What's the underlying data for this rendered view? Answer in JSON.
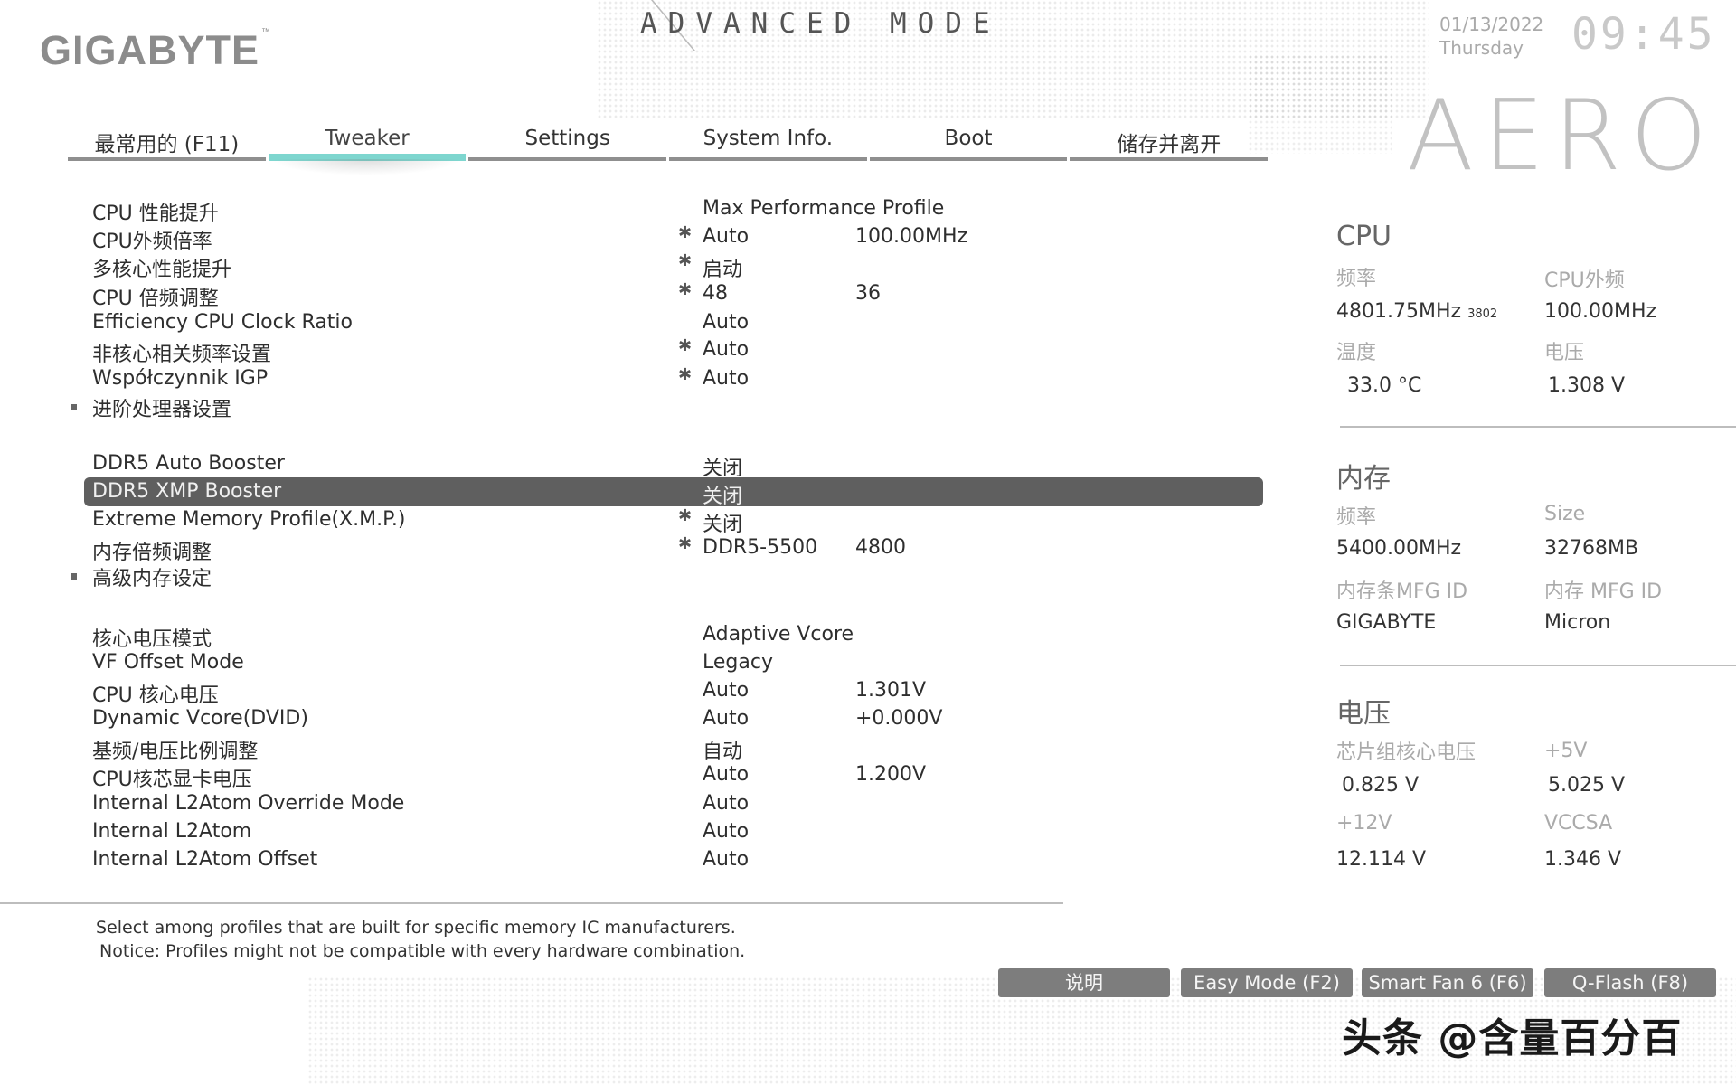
{
  "header": {
    "brand": "GIGABYTE",
    "brand_tm": "™",
    "mode_title": "ADVANCED MODE",
    "date": "01/13/2022",
    "weekday": "Thursday",
    "time": "09:45",
    "product_logo": "AERO"
  },
  "tabs": [
    {
      "label": "最常用的 (F11)"
    },
    {
      "label": "Tweaker",
      "active": true
    },
    {
      "label": "Settings"
    },
    {
      "label": "System Info."
    },
    {
      "label": "Boot"
    },
    {
      "label": "储存并离开"
    }
  ],
  "settings": [
    {
      "label": "CPU 性能提升",
      "value": "Max Performance Profile",
      "value2": "",
      "star": false,
      "submenu": false
    },
    {
      "label": "CPU外频倍率",
      "value": "Auto",
      "value2": "100.00MHz",
      "star": true,
      "submenu": false
    },
    {
      "label": "多核心性能提升",
      "value": "启动",
      "value2": "",
      "star": true,
      "submenu": false
    },
    {
      "label": "CPU 倍频调整",
      "value": "48",
      "value2": "36",
      "star": true,
      "submenu": false
    },
    {
      "label": "Efficiency CPU Clock Ratio",
      "value": "Auto",
      "value2": "",
      "star": false,
      "submenu": false
    },
    {
      "label": "非核心相关频率设置",
      "value": "Auto",
      "value2": "",
      "star": true,
      "submenu": false
    },
    {
      "label": "Współczynnik IGP",
      "value": "Auto",
      "value2": "",
      "star": true,
      "submenu": false
    },
    {
      "label": "进阶处理器设置",
      "value": "",
      "value2": "",
      "star": false,
      "submenu": true
    },
    {
      "label": "DDR5 Auto Booster",
      "value": "关闭",
      "value2": "",
      "star": false,
      "submenu": false
    },
    {
      "label": "DDR5 XMP Booster",
      "value": "关闭",
      "value2": "",
      "star": false,
      "submenu": false,
      "selected": true
    },
    {
      "label": "Extreme Memory Profile(X.M.P.)",
      "value": "关闭",
      "value2": "",
      "star": true,
      "submenu": false
    },
    {
      "label": "内存倍频调整",
      "value": "DDR5-5500",
      "value2": "4800",
      "star": true,
      "submenu": false
    },
    {
      "label": "高级内存设定",
      "value": "",
      "value2": "",
      "star": false,
      "submenu": true
    },
    {
      "label": "核心电压模式",
      "value": "Adaptive Vcore",
      "value2": "",
      "star": false,
      "submenu": false
    },
    {
      "label": "VF Offset Mode",
      "value": "Legacy",
      "value2": "",
      "star": false,
      "submenu": false
    },
    {
      "label": "CPU 核心电压",
      "value": "Auto",
      "value2": "1.301V",
      "star": false,
      "submenu": false
    },
    {
      "label": "Dynamic Vcore(DVID)",
      "value": "Auto",
      "value2": "+0.000V",
      "star": false,
      "submenu": false
    },
    {
      "label": "基频/电压比例调整",
      "value": "自动",
      "value2": "",
      "star": false,
      "submenu": false
    },
    {
      "label": "CPU核芯显卡电压",
      "value": "Auto",
      "value2": "1.200V",
      "star": false,
      "submenu": false
    },
    {
      "label": "Internal L2Atom Override Mode",
      "value": "Auto",
      "value2": "",
      "star": false,
      "submenu": false
    },
    {
      "label": "Internal L2Atom",
      "value": "Auto",
      "value2": "",
      "star": false,
      "submenu": false
    },
    {
      "label": "Internal L2Atom Offset",
      "value": "Auto",
      "value2": "",
      "star": false,
      "submenu": false
    }
  ],
  "help": {
    "line1": "Select among profiles that are built for specific memory IC manufacturers.",
    "line2": "Notice: Profiles might not be compatible with every hardware combination."
  },
  "sidebar": {
    "cpu": {
      "title": "CPU",
      "freq_label": "频率",
      "freq_value": "4801.75MHz",
      "freq_sub": "3802",
      "bclk_label": "CPU外频",
      "bclk_value": "100.00MHz",
      "temp_label": "温度",
      "temp_value": "33.0 °C",
      "volt_label": "电压",
      "volt_value": "1.308 V"
    },
    "memory": {
      "title": "内存",
      "freq_label": "频率",
      "freq_value": "5400.00MHz",
      "size_label": "Size",
      "size_value": "32768MB",
      "module_mfg_label": "内存条MFG ID",
      "module_mfg_value": "GIGABYTE",
      "chip_mfg_label": "内存 MFG ID",
      "chip_mfg_value": "Micron"
    },
    "voltage": {
      "title": "电压",
      "chipset_label": "芯片组核心电压",
      "chipset_value": "0.825 V",
      "v5_label": "+5V",
      "v5_value": "5.025 V",
      "v12_label": "+12V",
      "v12_value": "12.114 V",
      "vccsa_label": "VCCSA",
      "vccsa_value": "1.346 V"
    }
  },
  "buttons": {
    "help": "说明",
    "easy_mode": "Easy Mode (F2)",
    "smart_fan": "Smart Fan 6 (F6)",
    "qflash": "Q-Flash (F8)"
  },
  "watermark": "头条 @含量百分百"
}
